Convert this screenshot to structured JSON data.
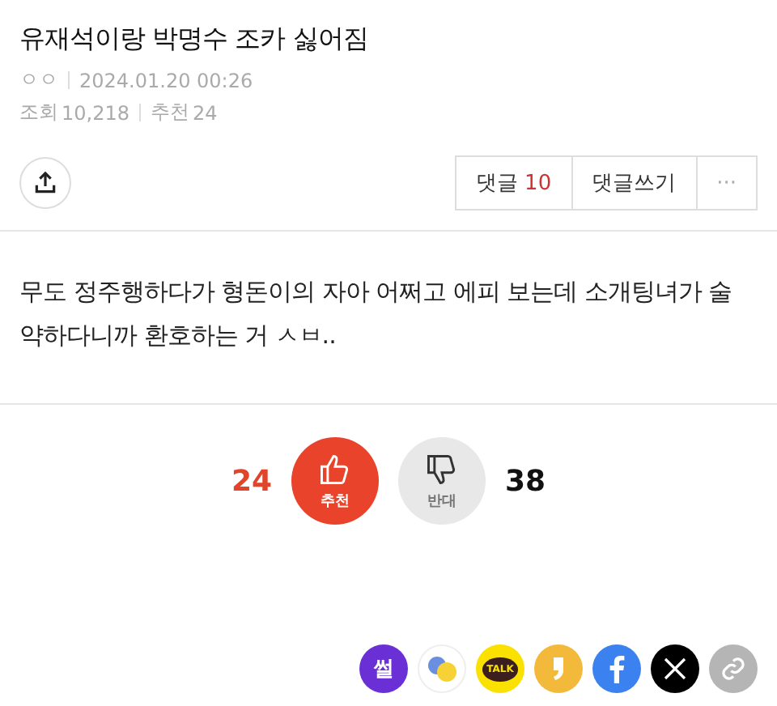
{
  "post": {
    "title": "유재석이랑 박명수 조카 싫어짐",
    "author": "ㅇㅇ",
    "date": "2024.01.20 00:26",
    "views_label": "조회",
    "views": "10,218",
    "recommend_label": "추천",
    "recommend": "24"
  },
  "actions": {
    "comments_label": "댓글",
    "comments_count": "10",
    "write_label": "댓글쓰기",
    "more": "···"
  },
  "body": "무도 정주행하다가 형돈이의 자아 어쩌고 에피 보는데 소개팅녀가 술 약하다니까 환호하는 거 ㅅㅂ..",
  "votes": [
    {
      "kind": "up",
      "count": "24",
      "label": "추천",
      "selected": true
    },
    {
      "kind": "down",
      "count": "38",
      "label": "반대",
      "selected": false
    }
  ],
  "share": [
    {
      "kind": "ssul",
      "label": "썰"
    },
    {
      "kind": "bubbles"
    },
    {
      "kind": "kakao",
      "label": "TALK"
    },
    {
      "kind": "quote"
    },
    {
      "kind": "facebook"
    },
    {
      "kind": "x"
    },
    {
      "kind": "link"
    }
  ]
}
